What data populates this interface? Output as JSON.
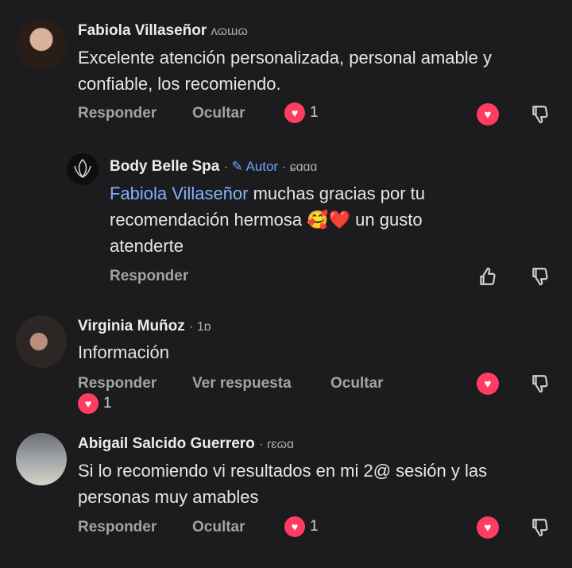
{
  "comments": [
    {
      "author": "Fabiola Villaseñor",
      "time": "ʌɷɯɷ",
      "text": "Excelente atención personalizada, personal amable y confiable, los recomiendo.",
      "actions": {
        "reply": "Responder",
        "hide": "Ocultar"
      },
      "reaction_count": "1"
    },
    {
      "author": "Body Belle Spa",
      "badge": "Autor",
      "time": "ɕɑɑɑ",
      "mention": "Fabiola Villaseñor",
      "text_line1": " muchas gracias por tu",
      "text_line2a": "recomendación hermosa ",
      "emoji": "🥰❤️",
      "text_line2b": " un gusto",
      "text_line3": "atenderte",
      "actions": {
        "reply": "Responder"
      }
    },
    {
      "author": "Virginia Muñoz",
      "time": "1ɒ",
      "text": "Información",
      "actions": {
        "reply": "Responder",
        "view_reply": "Ver respuesta",
        "hide": "Ocultar"
      },
      "reaction_count": "1"
    },
    {
      "author": "Abigail Salcido Guerrero",
      "time": "ɾɛɷɑ",
      "text_line1": "Si lo recomiendo vi resultados en mi 2@ sesión y las",
      "text_line2": "personas muy amables",
      "actions": {
        "reply": "Responder",
        "hide": "Ocultar"
      },
      "reaction_count": "1"
    }
  ],
  "icons": {
    "heart": "heart-icon",
    "like": "thumbs-up-icon",
    "dislike": "thumbs-down-icon",
    "pencil": "pencil-icon"
  },
  "colors": {
    "background": "#1c1c1e",
    "heart": "#ff3d61",
    "mention": "#7fb2ff",
    "author_badge": "#6aa4ff"
  }
}
